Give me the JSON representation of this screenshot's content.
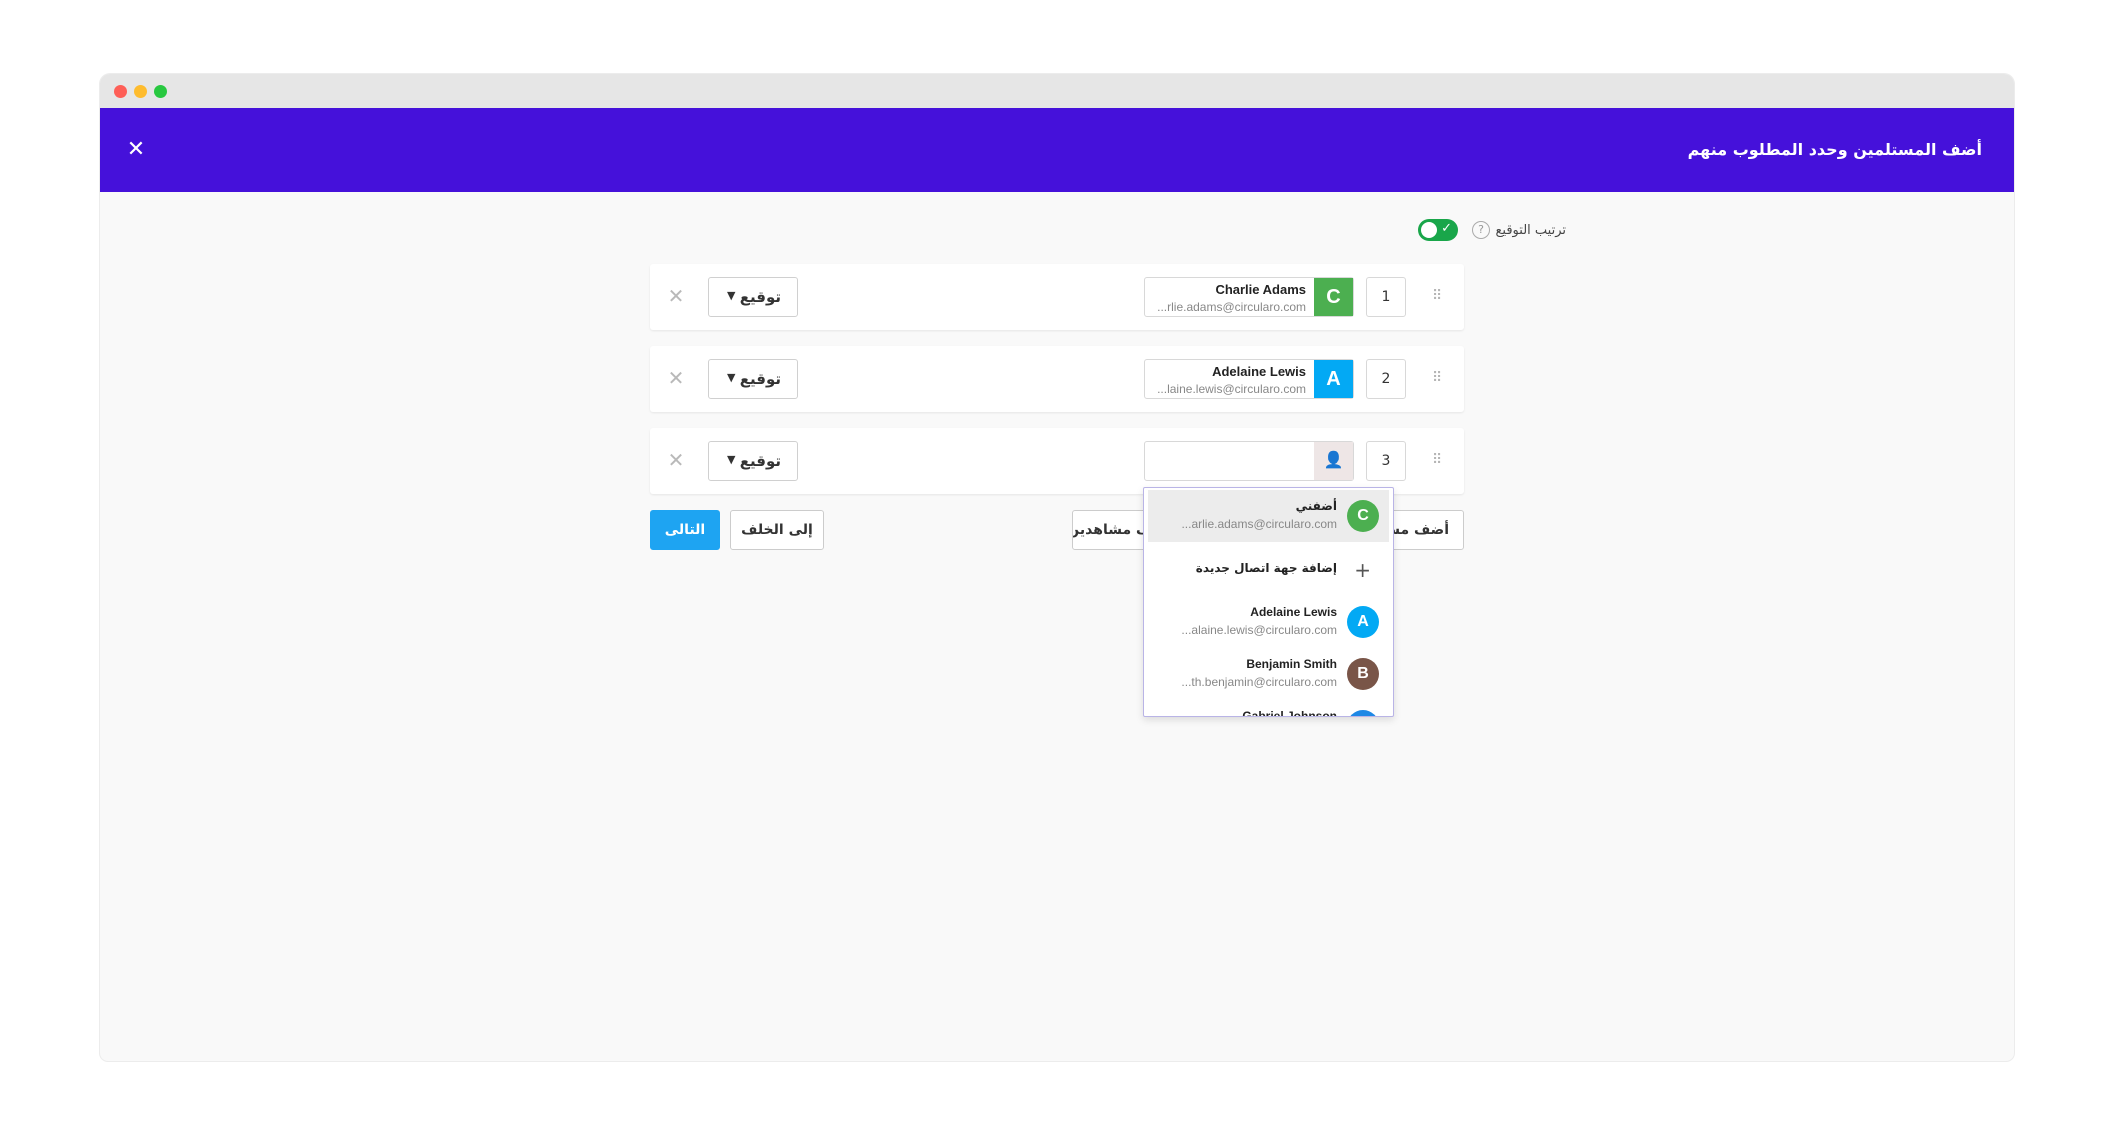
{
  "header": {
    "title": "أضف المستلمين وحدد المطلوب منهم",
    "close_icon": "close-icon"
  },
  "signing_order": {
    "label": "ترتيب التوقيع",
    "help": "?",
    "enabled": true
  },
  "recipients": [
    {
      "order": "1",
      "initial": "C",
      "name": "Charlie Adams",
      "email": "...rlie.adams@circularo.com",
      "color": "#4caf50",
      "role": "توقيع"
    },
    {
      "order": "2",
      "initial": "A",
      "name": "Adelaine Lewis",
      "email": "...laine.lewis@circularo.com",
      "color": "#03a9f4",
      "role": "توقيع"
    },
    {
      "order": "3",
      "initial": "",
      "name": "",
      "email": "",
      "color": "#eee6e6",
      "role": "توقيع"
    }
  ],
  "buttons": {
    "next": "التالى",
    "back": "إلى الخلف",
    "add_viewers": "أضف مشاهدين",
    "add_signer": "أضف مستلم"
  },
  "dropdown": {
    "me": {
      "initial": "C",
      "name": "أضفني",
      "email": "...arlie.adams@circularo.com",
      "color": "#4caf50"
    },
    "add_contact": "إضافة جهة اتصال جديدة",
    "contacts": [
      {
        "initial": "A",
        "name": "Adelaine Lewis",
        "email": "...alaine.lewis@circularo.com",
        "color": "#03a9f4"
      },
      {
        "initial": "B",
        "name": "Benjamin Smith",
        "email": "...th.benjamin@circularo.com",
        "color": "#795548"
      },
      {
        "initial": "G",
        "name": "Gabriel Johnson",
        "email": "",
        "color": "#1e88e5"
      }
    ]
  }
}
